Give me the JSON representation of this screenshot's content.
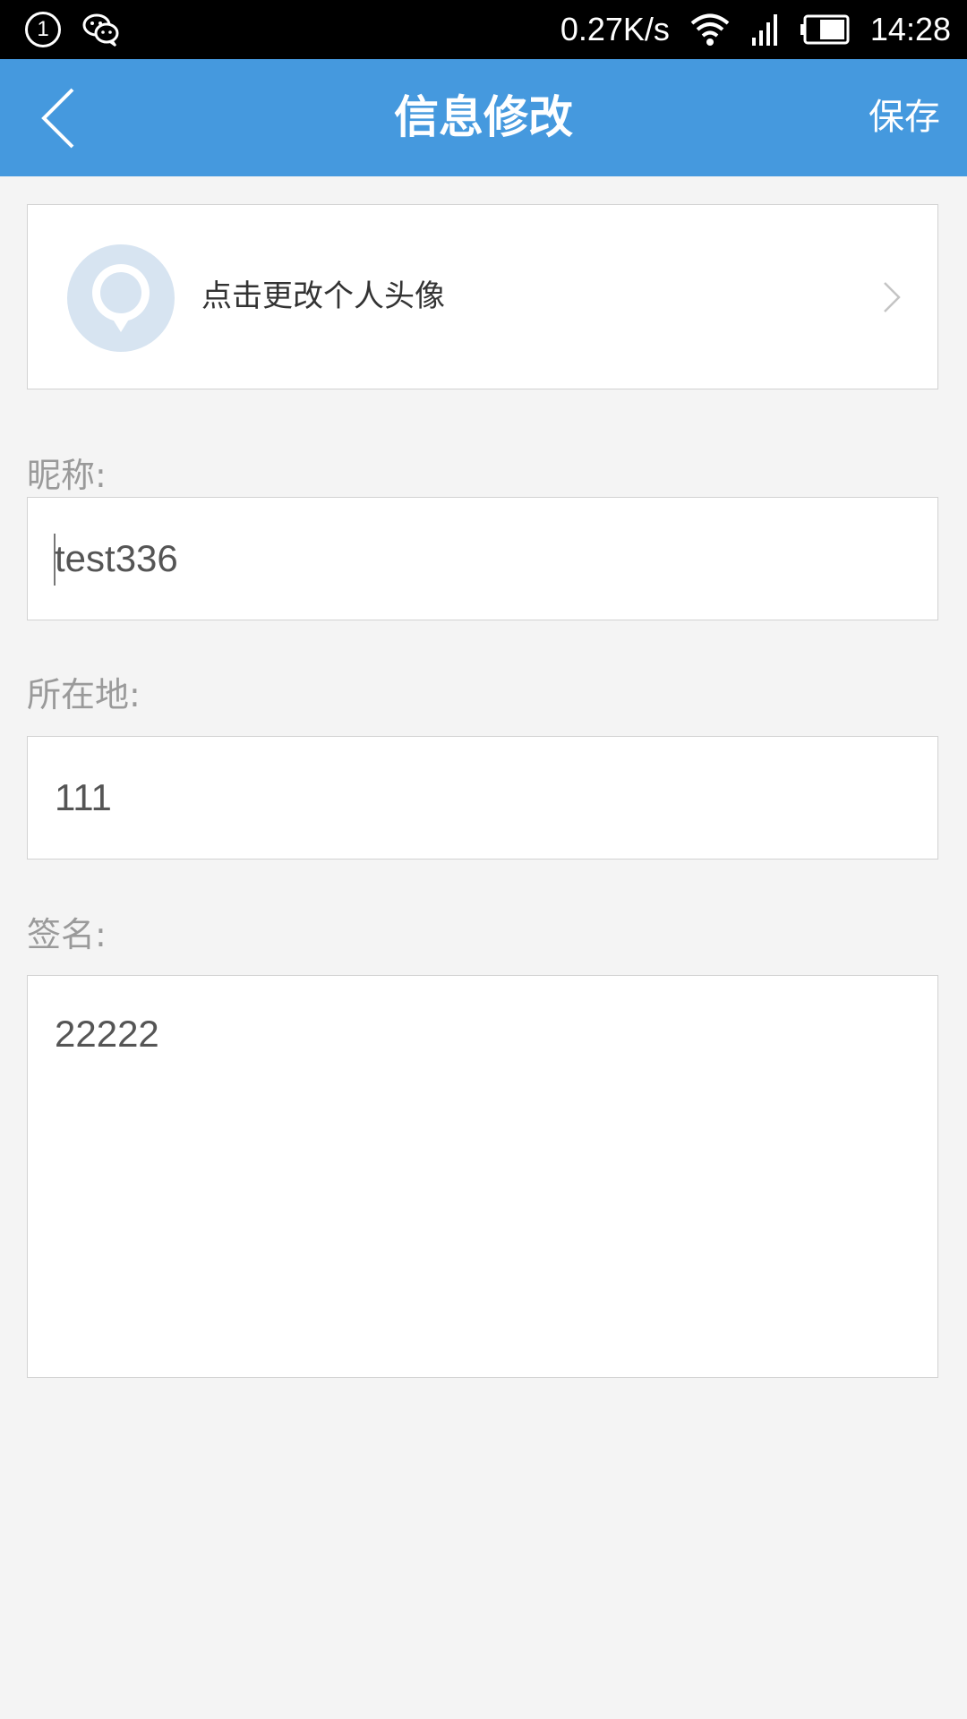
{
  "status_bar": {
    "notification_badge": "1",
    "net_speed": "0.27K/s",
    "time": "14:28",
    "icons": [
      "notification-one-icon",
      "wechat-icon",
      "wifi-icon",
      "signal-icon",
      "battery-icon"
    ]
  },
  "header": {
    "title": "信息修改",
    "save_label": "保存",
    "bg_color": "#4599de"
  },
  "avatar_row": {
    "label": "点击更改个人头像"
  },
  "form": {
    "nickname": {
      "label": "昵称:",
      "value": "test336"
    },
    "location": {
      "label": "所在地:",
      "value": "111"
    },
    "signature": {
      "label": "签名:",
      "value": "22222"
    }
  }
}
